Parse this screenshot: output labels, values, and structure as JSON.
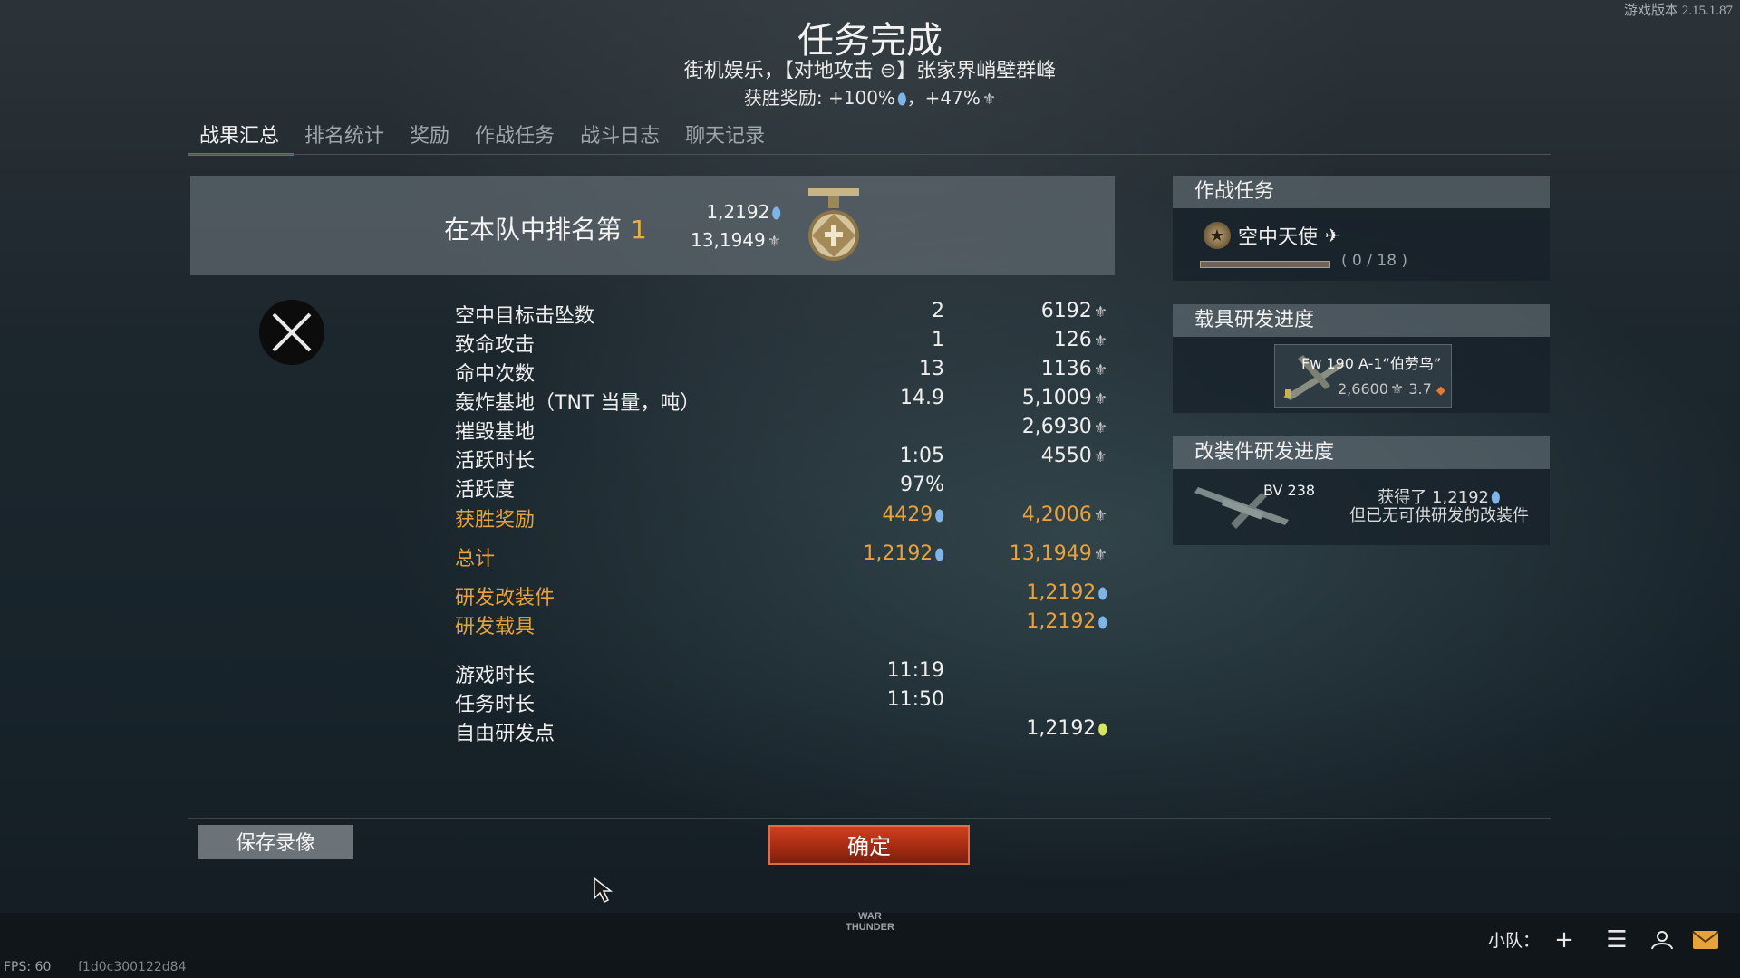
{
  "version": "游戏版本 2.15.1.87",
  "header": {
    "title": "任务完成",
    "subtitle": "街机娱乐，【对地攻击 ⊜】张家界峭壁群峰",
    "bonus": "获胜奖励: +100%",
    "bonus2": "，+47%"
  },
  "tabs": [
    "战果汇总",
    "排名统计",
    "奖励",
    "作战任务",
    "战斗日志",
    "聊天记录"
  ],
  "rank": {
    "label": "在本队中排名第",
    "position": "1",
    "research_points": "1,2192",
    "silver_lions": "13,1949"
  },
  "stats": [
    {
      "label": "空中目标击坠数",
      "value": "2",
      "reward": "6192"
    },
    {
      "label": "致命攻击",
      "value": "1",
      "reward": "126"
    },
    {
      "label": "命中次数",
      "value": "13",
      "reward": "1136"
    },
    {
      "label": "轰炸基地（TNT 当量，吨）",
      "value": "14.9",
      "reward": "5,1009"
    },
    {
      "label": "摧毁基地",
      "value": "",
      "reward": "2,6930"
    },
    {
      "label": "活跃时长",
      "value": "1:05",
      "reward": "4550"
    },
    {
      "label": "活跃度",
      "value": "97%",
      "reward": ""
    }
  ],
  "victory": {
    "label": "获胜奖励",
    "rp": "4429",
    "sl": "4,2006"
  },
  "total": {
    "label": "总计",
    "rp": "1,2192",
    "sl": "13,1949"
  },
  "research": {
    "mods_label": "研发改装件",
    "mods_rp": "1,2192",
    "vehicle_label": "研发载具",
    "vehicle_rp": "1,2192"
  },
  "times": {
    "game_label": "游戏时长",
    "game_value": "11:19",
    "mission_label": "任务时长",
    "mission_value": "11:50",
    "free_label": "自由研发点",
    "free_value": "1,2192"
  },
  "side": {
    "tasks_title": "作战任务",
    "task_name": "空中天使",
    "task_progress": "( 0 / 18 )",
    "vehicle_title": "载具研发进度",
    "vehicle_name": "Fw 190 A-1“伯劳鸟”",
    "vehicle_cost": "2,6600",
    "vehicle_br": "3.7",
    "mods_title": "改装件研发进度",
    "mods_vehicle": "BV 238",
    "mods_got": "获得了 1,2192",
    "mods_note": "但已无可供研发的改装件"
  },
  "buttons": {
    "save": "保存录像",
    "ok": "确定"
  },
  "footer": {
    "logo_top": "WAR",
    "logo_bottom": "THUNDER",
    "squad": "小队：",
    "fps": "FPS: 60",
    "hash": "f1d0c300122d84"
  },
  "colors": {
    "accent": "#d24a2a",
    "gold": "#e8a23a",
    "rp": "#7fb4e8",
    "free_rp": "#d6e85a"
  }
}
